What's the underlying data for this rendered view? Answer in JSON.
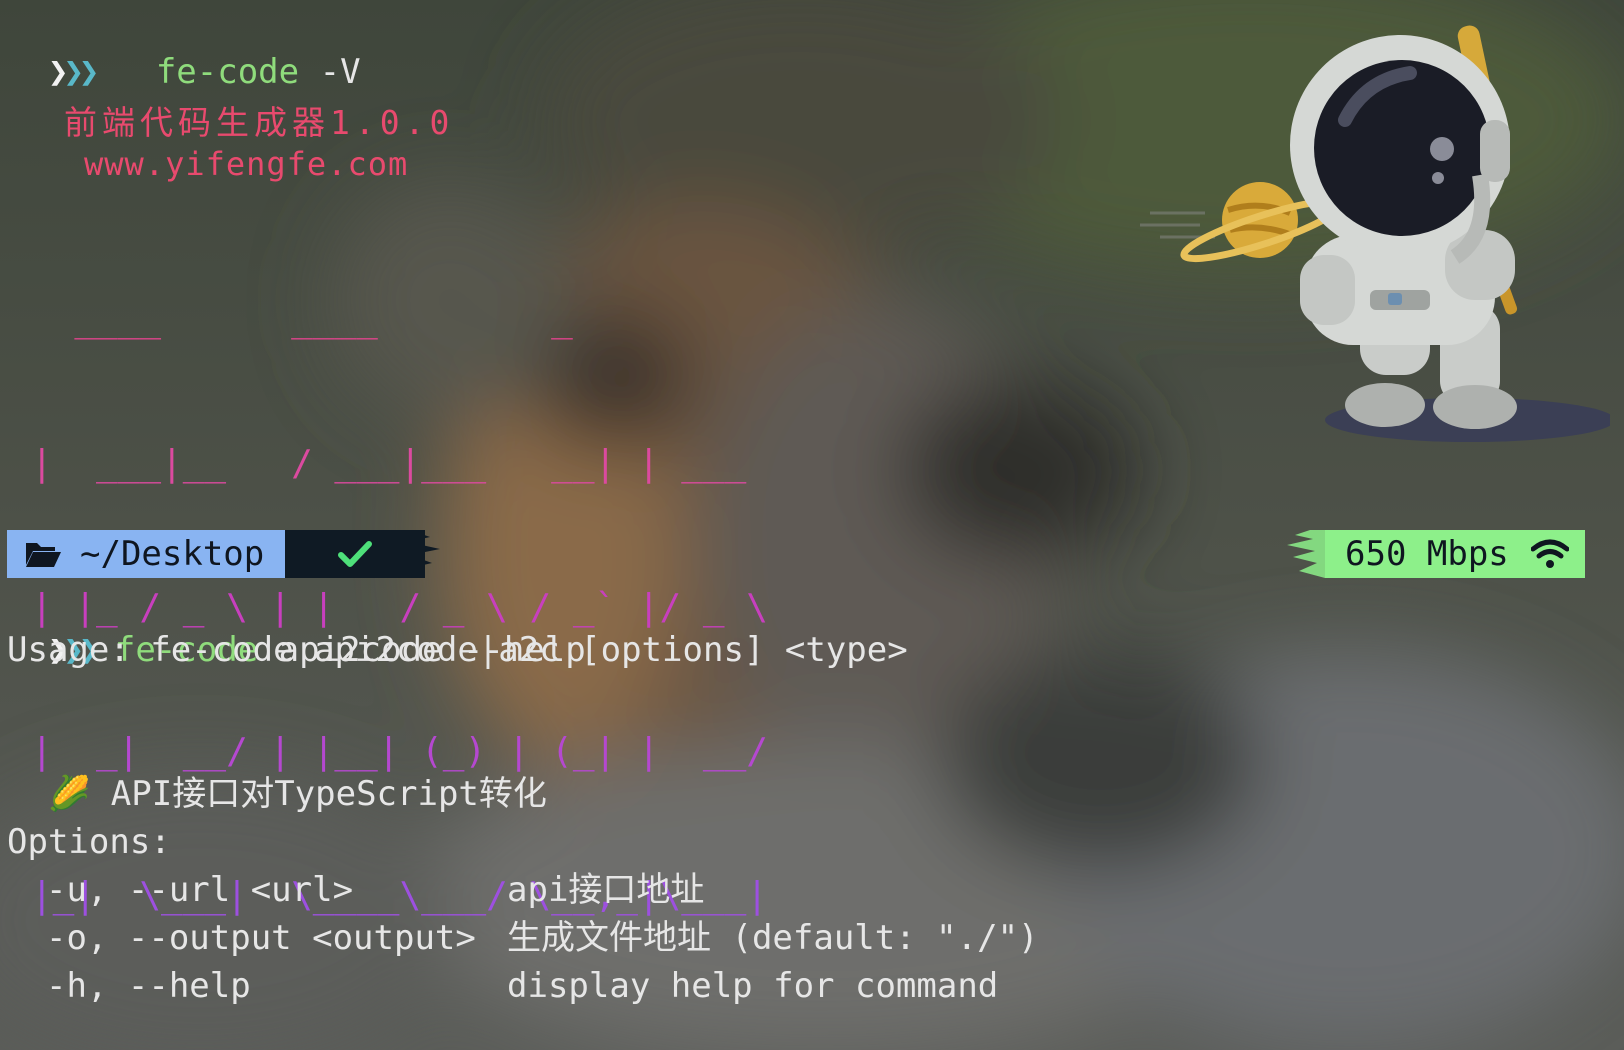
{
  "terminal": {
    "prompt_chevrons": [
      "❯",
      "❯",
      "❯"
    ],
    "first_command": {
      "program": "fe-code",
      "args": "-V"
    },
    "banner": {
      "title": "前端代码生成器1.0.0",
      "url": "www.yifengfe.com"
    },
    "ascii_art": [
      "  ____      ____        _",
      "|  ___|__   / ___|___   __| | ___",
      "| |_ / _ \\ | |   / _ \\ / _` |/ _ \\",
      "|  _|  __/ | |__| (_) | (_| |  __/",
      "|_|  \\___|  \\____\\___/ \\__,_|\\___|"
    ],
    "status_bar": {
      "directory": "~/Desktop",
      "folder_icon": "folder-open-icon",
      "status_icon": "checkmark-icon",
      "network_speed": "650 Mbps",
      "network_icon": "wifi-icon"
    },
    "second_command": {
      "program": "fe-code",
      "args": "api2code --help"
    },
    "usage": "Usage: fe-code api2code|a2c [options] <type>",
    "description": {
      "emoji": "🌽",
      "text": "API接口对TypeScript转化"
    },
    "options_header": "Options:",
    "options": [
      {
        "flag": "-u, --url <url>",
        "desc": "api接口地址"
      },
      {
        "flag": "-o, --output <output>",
        "desc": "生成文件地址 (default: \"./\")"
      },
      {
        "flag": "-h, --help",
        "desc": "display help for command"
      }
    ]
  },
  "colors": {
    "command": "#8fdc7c",
    "banner": "#e84a6e",
    "dir_segment": "#89b4f2",
    "net_segment": "#8df08a",
    "check": "#4ee07a"
  }
}
